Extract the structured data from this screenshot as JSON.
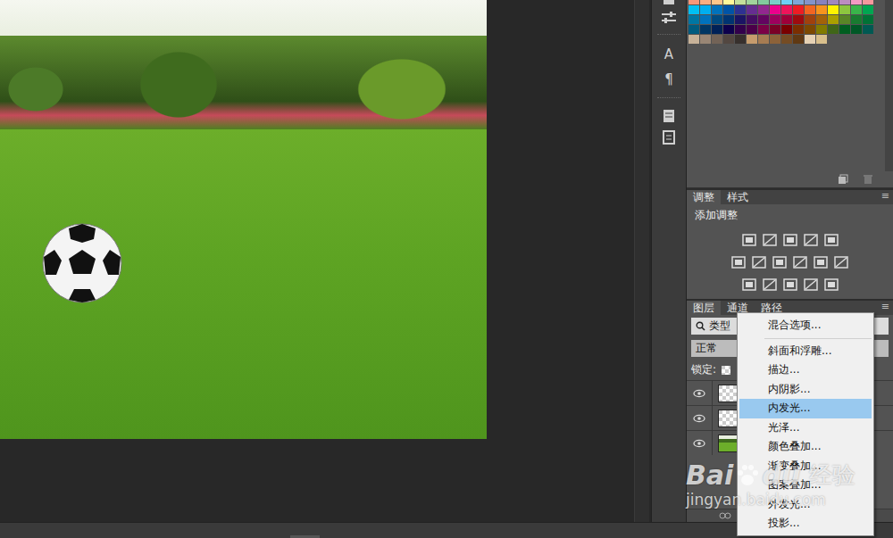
{
  "toolbar": {
    "glyphs": [
      "A",
      "¶"
    ]
  },
  "swatches": [
    [
      "#f7977a",
      "#f9ad81",
      "#fdc68a",
      "#fff79a",
      "#c4df9b",
      "#a2d39c",
      "#82ca9d",
      "#7bcdc8",
      "#6ecff6",
      "#7ea7d8",
      "#8493ca",
      "#8882be",
      "#a187be",
      "#bc8dbf",
      "#f49ac2",
      "#f6989d"
    ],
    [
      "#00bff3",
      "#00aeef",
      "#0072bc",
      "#0054a6",
      "#2e3192",
      "#662d91",
      "#92278f",
      "#ec008c",
      "#ed145b",
      "#ed1c24",
      "#f26522",
      "#f7941d",
      "#fff200",
      "#8dc63f",
      "#39b54a",
      "#00a651"
    ],
    [
      "#0076a3",
      "#0072bc",
      "#004a80",
      "#003471",
      "#1b1464",
      "#440e62",
      "#630460",
      "#9e005d",
      "#9e0039",
      "#9e0b0f",
      "#a0410d",
      "#a36209",
      "#aba000",
      "#598527",
      "#197b30",
      "#007236"
    ],
    [
      "#005b7f",
      "#003663",
      "#002157",
      "#0d004c",
      "#32004b",
      "#4b0049",
      "#7b0046",
      "#7a0026",
      "#790000",
      "#7b2e00",
      "#7d4900",
      "#827b00",
      "#406618",
      "#005e20",
      "#005826",
      "#005952"
    ],
    [
      "#c7b299",
      "#998675",
      "#736357",
      "#534741",
      "#37302d",
      "#c69c6d",
      "#a67c52",
      "#8c6239",
      "#754c24",
      "#603913",
      "#e6d2b4",
      "#d9bf8c"
    ]
  ],
  "adjustments": {
    "tabs": [
      {
        "label": "调整",
        "selected": true
      },
      {
        "label": "样式",
        "selected": false
      }
    ],
    "title": "添加调整"
  },
  "layers_panel": {
    "tabs": [
      {
        "label": "图层",
        "selected": true
      },
      {
        "label": "通道",
        "selected": false
      },
      {
        "label": "路径",
        "selected": false
      }
    ],
    "filter": "类型",
    "blend_mode": "正常",
    "lock_label": "锁定:",
    "layers": [
      {
        "visible": true,
        "selected": false,
        "kind": "transparent"
      },
      {
        "visible": true,
        "selected": false,
        "kind": "transparent"
      },
      {
        "visible": true,
        "selected": false,
        "kind": "photo"
      }
    ]
  },
  "context_menu": {
    "items": [
      {
        "label": "混合选项...",
        "selected": false,
        "separator_after": true
      },
      {
        "label": "斜面和浮雕...",
        "selected": false,
        "separator_after": false
      },
      {
        "label": "描边...",
        "selected": false,
        "separator_after": false
      },
      {
        "label": "内阴影...",
        "selected": false,
        "separator_after": false
      },
      {
        "label": "内发光...",
        "selected": true,
        "separator_after": false
      },
      {
        "label": "光泽...",
        "selected": false,
        "separator_after": false
      },
      {
        "label": "颜色叠加...",
        "selected": false,
        "separator_after": false
      },
      {
        "label": "渐变叠加...",
        "selected": false,
        "separator_after": false
      },
      {
        "label": "图案叠加...",
        "selected": false,
        "separator_after": false
      },
      {
        "label": "外发光...",
        "selected": false,
        "separator_after": false
      },
      {
        "label": "投影...",
        "selected": false,
        "separator_after": false
      }
    ]
  },
  "watermark": {
    "brand": "Bai",
    "brand_suffix": "du",
    "label": "经验",
    "url": "jingyan.baidu.com"
  }
}
